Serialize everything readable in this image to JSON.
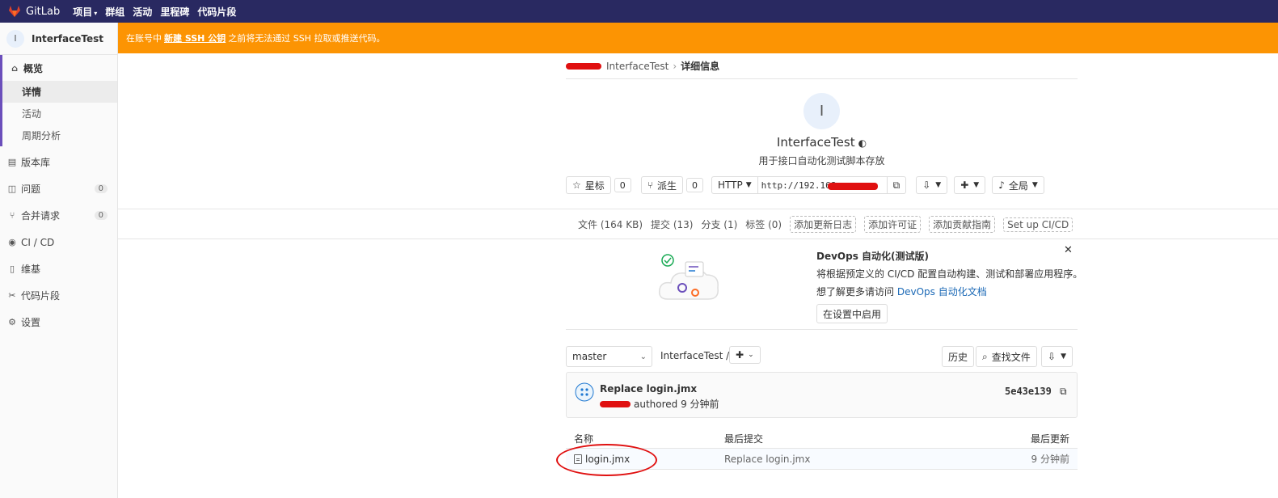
{
  "topbar": {
    "brand": "GitLab",
    "nav": [
      "项目",
      "群组",
      "活动",
      "里程碑",
      "代码片段"
    ],
    "bg_color": "#292961"
  },
  "sidebar": {
    "project_initial": "I",
    "project_name": "InterfaceTest",
    "overview_label": "概览",
    "overview_sub": [
      "详情",
      "活动",
      "周期分析"
    ],
    "items": [
      {
        "label": "版本库",
        "icon": "book-icon"
      },
      {
        "label": "问题",
        "icon": "issues-icon",
        "count": "0"
      },
      {
        "label": "合并请求",
        "icon": "merge-request-icon",
        "count": "0"
      },
      {
        "label": "CI / CD",
        "icon": "rocket-icon"
      },
      {
        "label": "维基",
        "icon": "book-icon"
      },
      {
        "label": "代码片段",
        "icon": "scissors-icon"
      },
      {
        "label": "设置",
        "icon": "gear-icon"
      }
    ]
  },
  "banner": {
    "prefix": "在账号中",
    "link": "新建 SSH 公钥",
    "suffix": "之前将无法通过 SSH 拉取或推送代码。",
    "color": "#fc9403"
  },
  "breadcrumb": {
    "project": "InterfaceTest",
    "current": "详细信息"
  },
  "project": {
    "initial": "I",
    "title": "InterfaceTest",
    "description": "用于接口自动化测试脚本存放",
    "star_label": "星标",
    "star_count": "0",
    "fork_label": "派生",
    "fork_count": "0",
    "protocol": "HTTP",
    "clone_url": "http://192.168.",
    "notify_label": "全局"
  },
  "stats": {
    "files": "文件 (164 KB)",
    "commits": "提交 (13)",
    "branches": "分支 (1)",
    "tags": "标签 (0)",
    "add_changelog": "添加更新日志",
    "add_license": "添加许可证",
    "add_contributing": "添加贡献指南",
    "setup_ci": "Set up CI/CD"
  },
  "devops": {
    "title": "DevOps 自动化(测试版)",
    "line1": "将根据预定义的 CI/CD 配置自动构建、测试和部署应用程序。",
    "line2_prefix": "想了解更多请访问",
    "line2_link": "DevOps 自动化文档",
    "enable_button": "在设置中启用"
  },
  "tree": {
    "branch": "master",
    "path": "InterfaceTest /",
    "history_button": "历史",
    "find_file_button": "查找文件"
  },
  "last_commit": {
    "message": "Replace login.jmx",
    "meta": "authored 9 分钟前",
    "sha": "5e43e139"
  },
  "file_table": {
    "headers": [
      "名称",
      "最后提交",
      "最后更新"
    ],
    "rows": [
      {
        "name": "login.jmx",
        "commit": "Replace login.jmx",
        "updated": "9 分钟前"
      }
    ]
  }
}
